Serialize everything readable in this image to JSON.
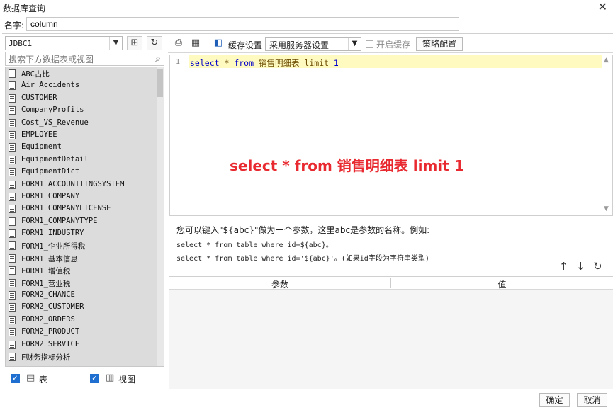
{
  "window": {
    "title": "数据库查询",
    "close": "✕"
  },
  "name_row": {
    "label": "名字:",
    "value": "column"
  },
  "left_panel": {
    "datasource": "JDBC1",
    "search_placeholder": "搜索下方数据表或视图",
    "tables": [
      "ABC占比",
      "Air_Accidents",
      "CUSTOMER",
      "CompanyProfits",
      "Cost_VS_Revenue",
      "EMPLOYEE",
      "Equipment",
      "EquipmentDetail",
      "EquipmentDict",
      "FORM1_ACCOUNTTINGSYSTEM",
      "FORM1_COMPANY",
      "FORM1_COMPANYLICENSE",
      "FORM1_COMPANYTYPE",
      "FORM1_INDUSTRY",
      "FORM1_企业所得税",
      "FORM1_基本信息",
      "FORM1_增值税",
      "FORM1_营业税",
      "FORM2_CHANCE",
      "FORM2_CUSTOMER",
      "FORM2_ORDERS",
      "FORM2_PRODUCT",
      "FORM2_SERVICE",
      "F财务指标分析"
    ],
    "filter_table_label": "表",
    "filter_view_label": "视图"
  },
  "toolbar": {
    "cache_label": "缓存设置",
    "cache_value": "采用服务器设置",
    "open_cache_label": "开启缓存",
    "strategy_button": "策略配置"
  },
  "editor": {
    "line_number": "1",
    "sql_kw1": "select",
    "sql_star": " * ",
    "sql_kw2": "from",
    "sql_table": " 销售明细表 limit ",
    "sql_num": "1",
    "overlay_text": "select * from 销售明细表 limit 1"
  },
  "hint": {
    "line1": "您可以键入\"${abc}\"做为一个参数，这里abc是参数的名称。例如:",
    "line2": "select * from table where id=${abc}。",
    "line3": "select * from table where id='${abc}'。(如果id字段为字符串类型)"
  },
  "params_table": {
    "col_param": "参数",
    "col_value": "值"
  },
  "footer": {
    "ok": "确定",
    "cancel": "取消"
  }
}
